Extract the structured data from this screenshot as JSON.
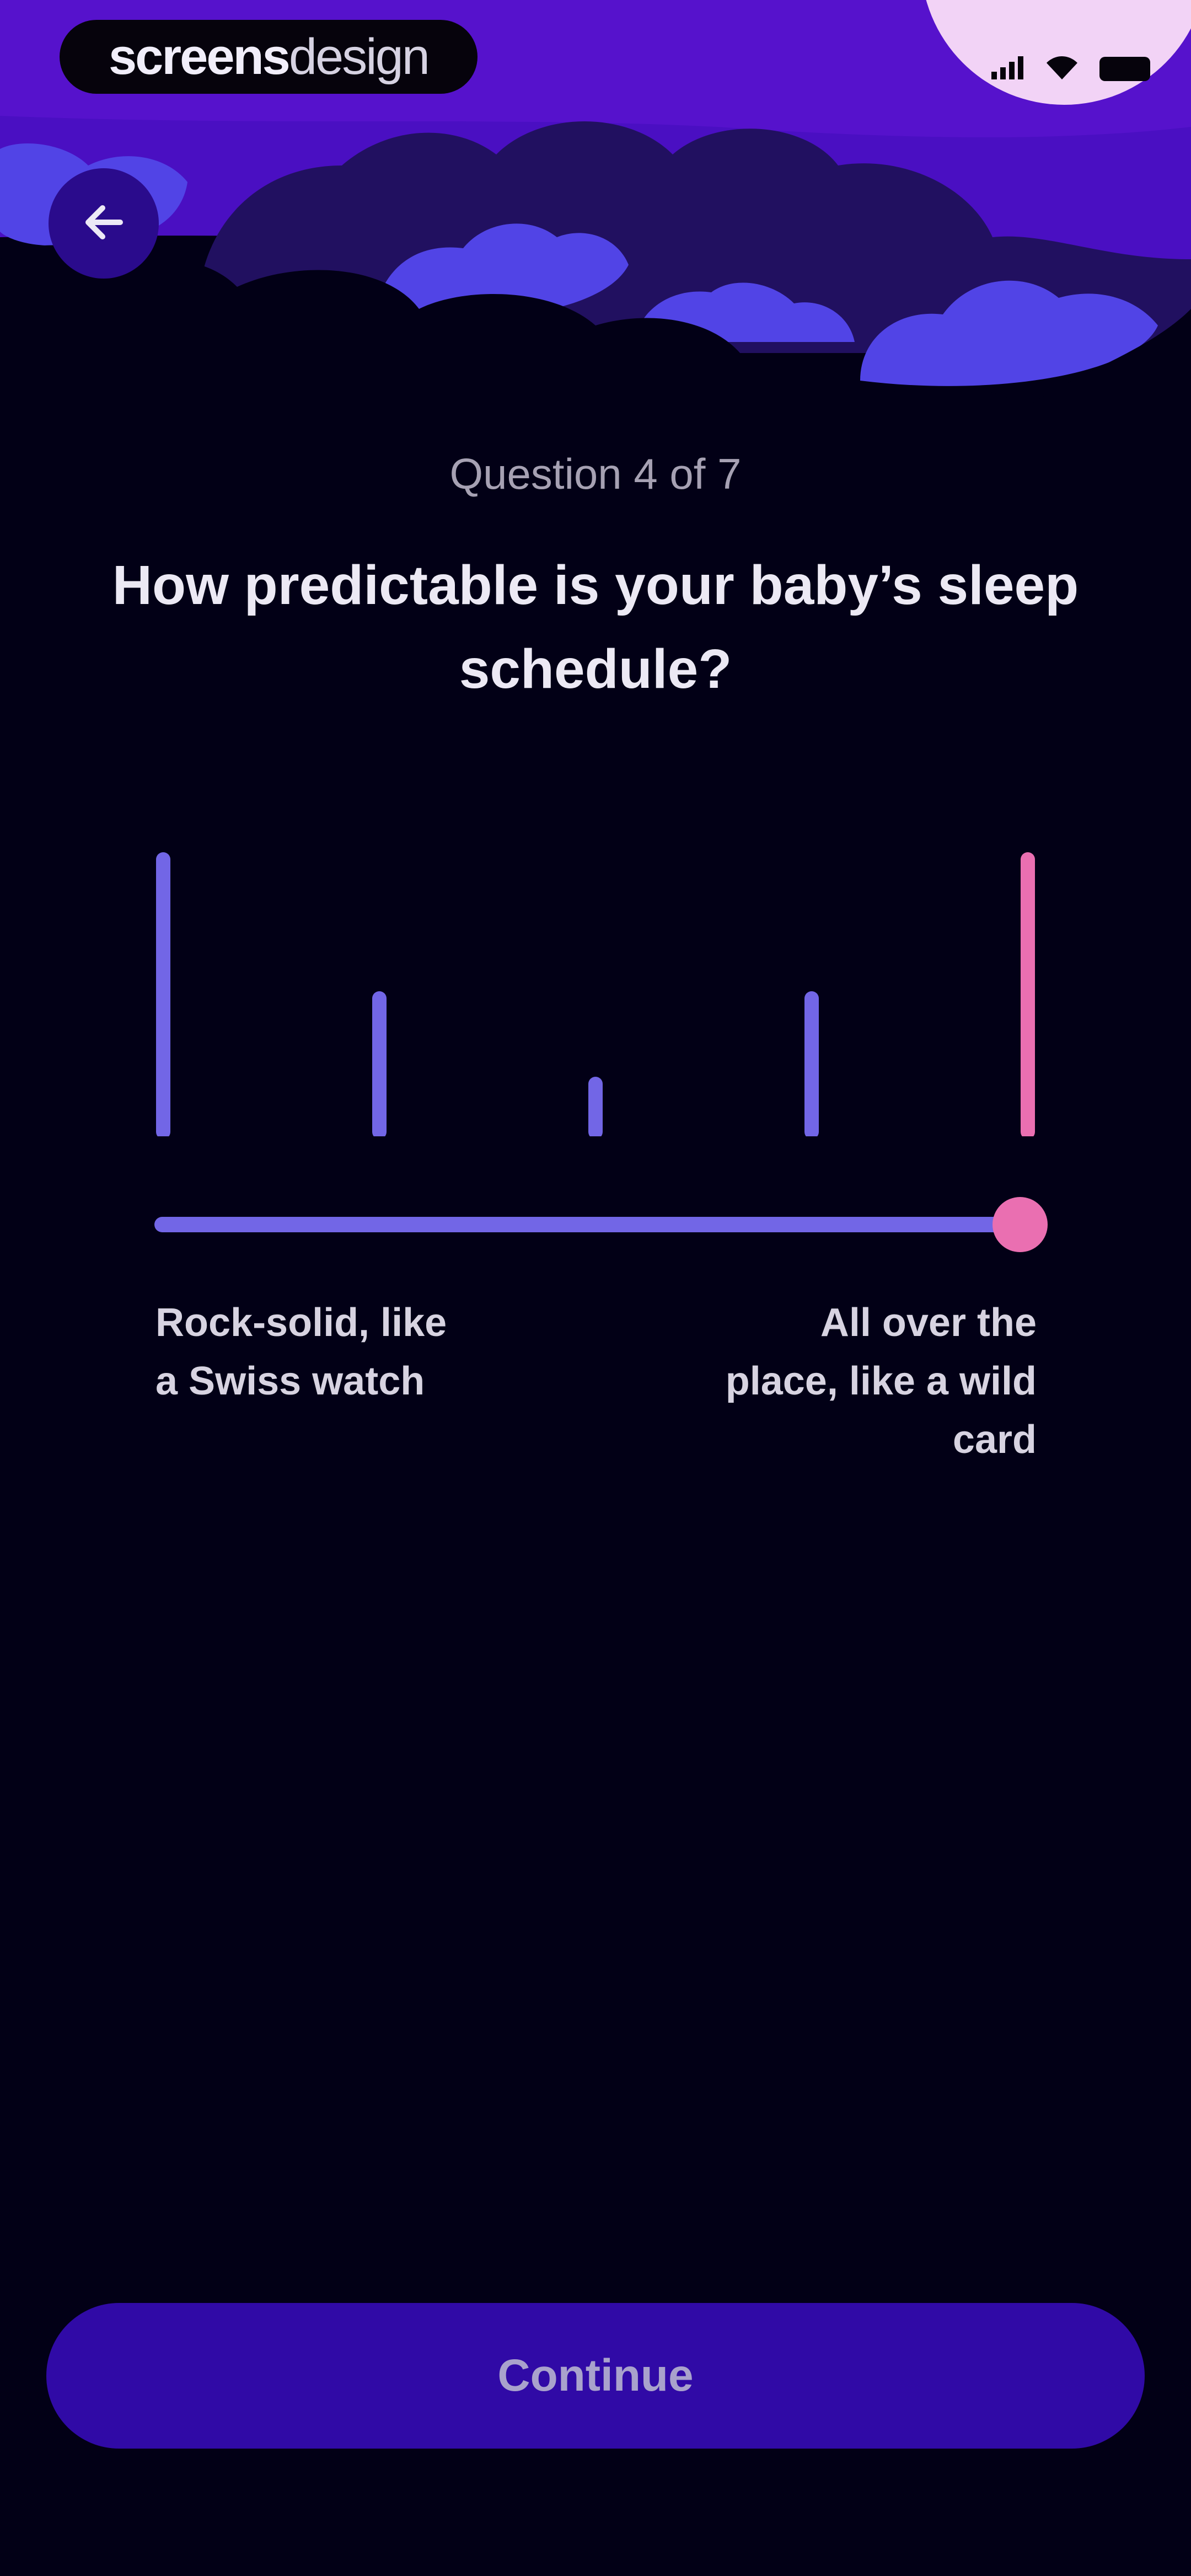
{
  "brand": {
    "part1": "screens",
    "part2": "design"
  },
  "status_bar": {
    "icons": [
      "signal-icon",
      "wifi-icon",
      "battery-icon"
    ]
  },
  "header": {
    "back_icon": "arrow-left-icon"
  },
  "question": {
    "progress": "Question 4 of 7",
    "title": "How predictable is your baby’s sleep schedule?"
  },
  "scale": {
    "steps": 5,
    "selected_index": 4,
    "selected_fraction": 1.0,
    "left_label": "Rock-solid, like a Swiss watch",
    "right_label": "All over the place, like a wild card"
  },
  "actions": {
    "continue_label": "Continue"
  },
  "colors": {
    "background": "#020016",
    "hero_purple": "#4a0fc2",
    "accent_violet": "#7266e6",
    "accent_pink": "#ea6fb1",
    "button": "#300aa6"
  }
}
